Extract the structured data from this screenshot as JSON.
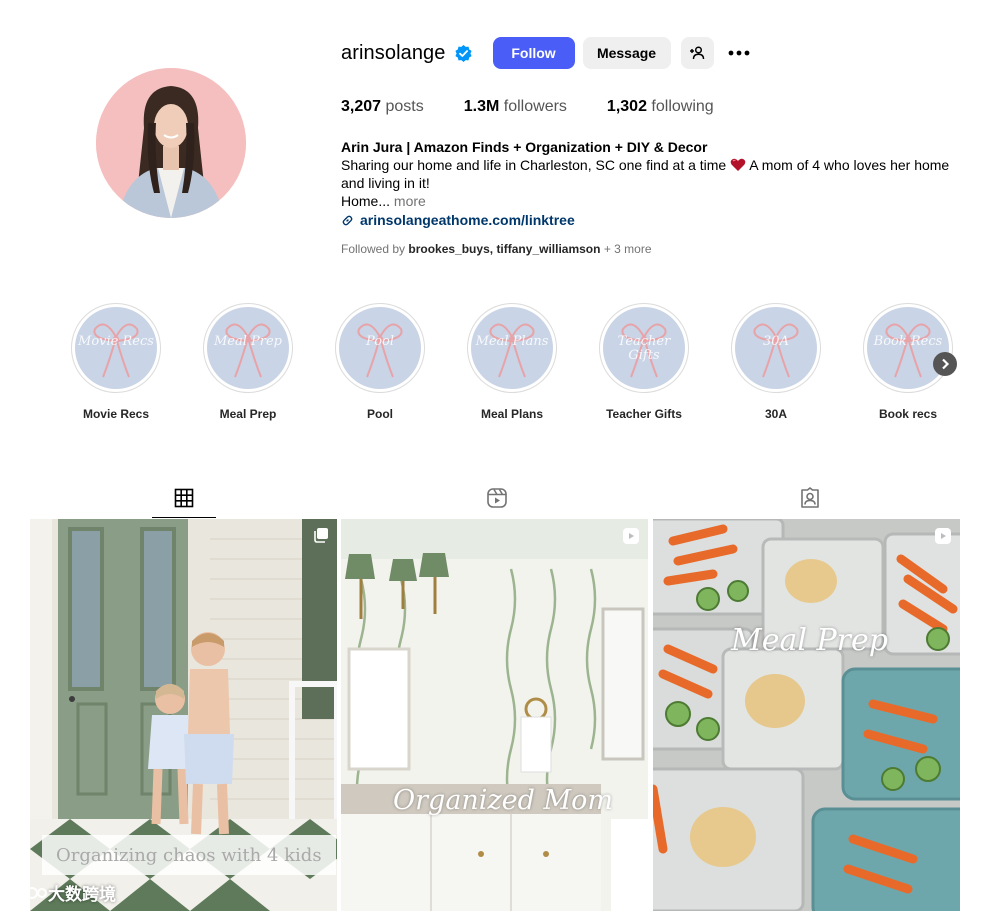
{
  "profile": {
    "username": "arinsolange",
    "follow_label": "Follow",
    "message_label": "Message",
    "stats": {
      "posts_count": "3,207",
      "posts_label": "posts",
      "followers_count": "1.3M",
      "followers_label": "followers",
      "following_count": "1,302",
      "following_label": "following"
    },
    "bio": {
      "name": "Arin Jura | Amazon Finds + Organization + DIY & Decor",
      "line1": "Sharing our home and life in Charleston, SC one find at a time",
      "line1b": "A mom of 4 who loves her home",
      "line2": "and living in it!",
      "line3": "Home...",
      "more_label": "more",
      "link": "arinsolangeathome.com/linktree"
    },
    "followed_by": {
      "prefix": "Followed by",
      "user1": "brookes_buys",
      "user2": "tiffany_williamson",
      "suffix": "+ 3 more"
    }
  },
  "highlights": [
    {
      "label": "Movie Recs",
      "cover": "Movie Recs"
    },
    {
      "label": "Meal Prep",
      "cover": "Meal Prep"
    },
    {
      "label": "Pool",
      "cover": "Pool"
    },
    {
      "label": "Meal Plans",
      "cover": "Meal Plans"
    },
    {
      "label": "Teacher Gifts",
      "cover": "Teacher Gifts"
    },
    {
      "label": "30A",
      "cover": "30A"
    },
    {
      "label": "Book recs",
      "cover": "Book Recs"
    }
  ],
  "tabs": [
    {
      "icon": "grid-icon",
      "active": true
    },
    {
      "icon": "reels-icon",
      "active": false
    },
    {
      "icon": "tagged-icon",
      "active": false
    }
  ],
  "posts": [
    {
      "overlay": "Organizing chaos with 4 kids",
      "badge": "carousel-icon"
    },
    {
      "overlay": "Organized Mom",
      "badge": "reel-icon"
    },
    {
      "overlay": "Meal Prep",
      "badge": "reel-icon"
    }
  ],
  "watermark": "大数跨境",
  "colors": {
    "follow_button": "#4a5df6",
    "secondary_button": "#efefef",
    "link": "#00376b",
    "verified": "#0095f6",
    "avatar_bg": "#f5bfc0",
    "highlight_bg": "#c9d4e6"
  }
}
